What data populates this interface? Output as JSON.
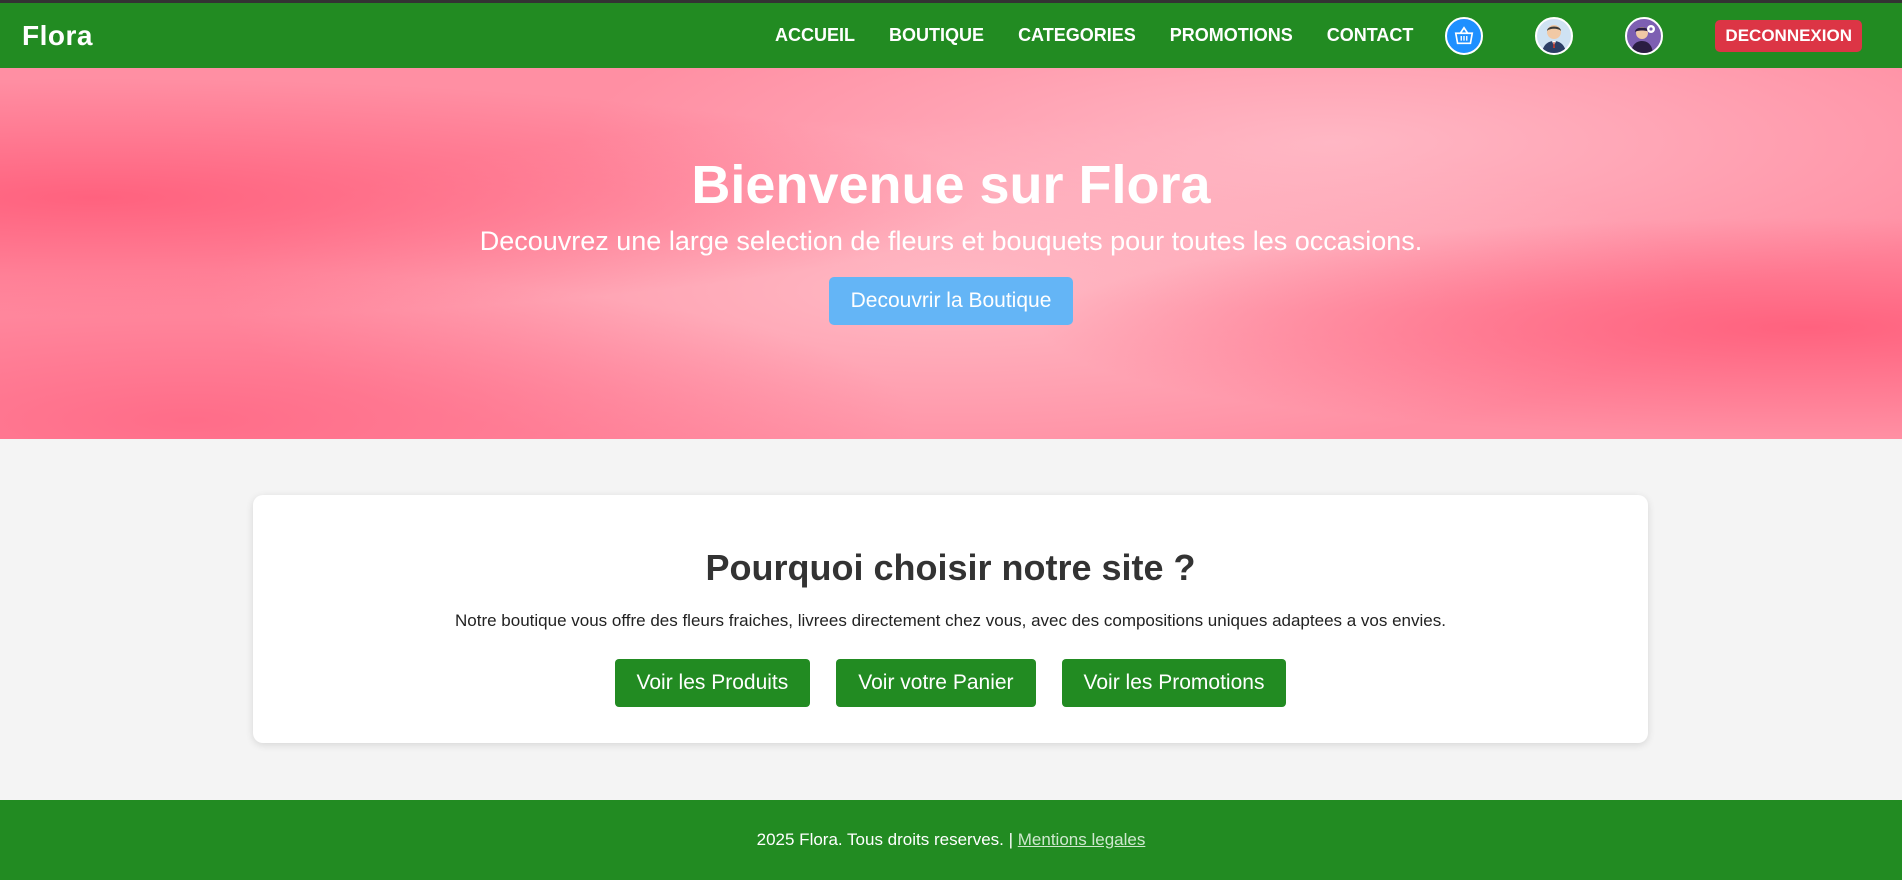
{
  "header": {
    "logo": "Flora",
    "nav": [
      "ACCUEIL",
      "BOUTIQUE",
      "CATEGORIES",
      "PROMOTIONS",
      "CONTACT"
    ],
    "icons": [
      "basket-icon",
      "user-profile-icon",
      "admin-settings-icon"
    ],
    "logout_label": "DECONNEXION"
  },
  "hero": {
    "title": "Bienvenue sur Flora",
    "subtitle": "Decouvrez une large selection de fleurs et bouquets pour toutes les occasions.",
    "cta_label": "Decouvrir la Boutique"
  },
  "card": {
    "title": "Pourquoi choisir notre site ?",
    "text": "Notre boutique vous offre des fleurs fraiches, livrees directement chez vous, avec des compositions uniques adaptees a vos envies.",
    "buttons": [
      "Voir les Produits",
      "Voir votre Panier",
      "Voir les Promotions"
    ]
  },
  "footer": {
    "copyright": "2025 Flora. Tous droits reserves. |",
    "link": "Mentions legales"
  },
  "colors": {
    "primary_green": "#228b22",
    "logout_red": "#dc3545",
    "cta_blue": "#64b5f6",
    "hero_pink": "#ff8fa3"
  }
}
